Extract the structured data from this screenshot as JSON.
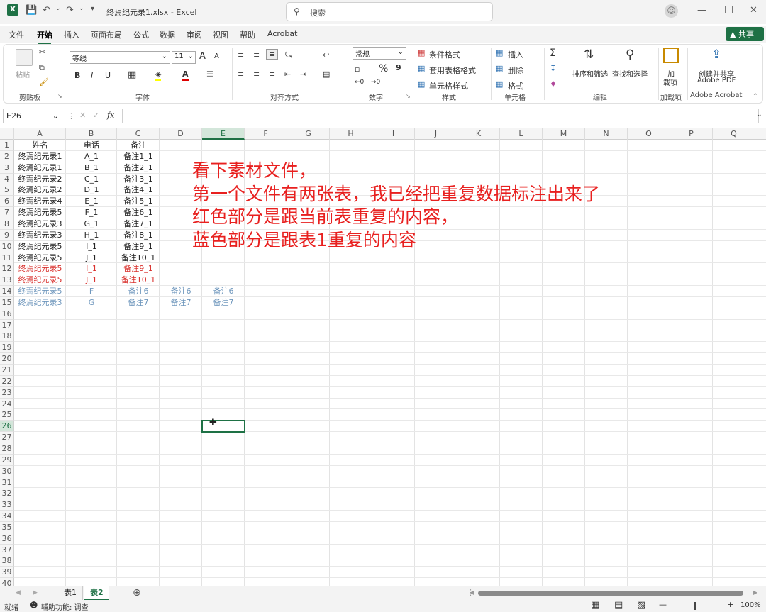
{
  "app": {
    "filename": "终焉纪元录1.xlsx",
    "separator": "-",
    "app_name": "Excel"
  },
  "search": {
    "placeholder": "搜索"
  },
  "ribbon_tabs": [
    "文件",
    "开始",
    "插入",
    "页面布局",
    "公式",
    "数据",
    "审阅",
    "视图",
    "帮助",
    "Acrobat"
  ],
  "share_label": "共享",
  "clipboard": {
    "paste": "粘贴",
    "group": "剪贴板"
  },
  "font": {
    "name": "等线",
    "size": "11",
    "bold": "B",
    "italic": "I",
    "underline": "U",
    "group": "字体",
    "grow": "A",
    "shrink": "A"
  },
  "alignment": {
    "group": "对齐方式"
  },
  "number": {
    "format": "常规",
    "percent": "%",
    "comma": "9",
    "group": "数字"
  },
  "styles": {
    "cond": "条件格式",
    "table": "套用表格格式",
    "cell": "单元格样式",
    "group": "样式"
  },
  "cells": {
    "insert": "插入",
    "delete": "删除",
    "format": "格式",
    "group": "单元格"
  },
  "editing": {
    "sum": "Σ",
    "sort": "排序和筛选",
    "find": "查找和选择",
    "group": "编辑"
  },
  "addins": {
    "label1": "加",
    "label2": "载项",
    "group": "加载项"
  },
  "acrobat": {
    "label1": "创建并共享",
    "label2": "Adobe PDF",
    "group": "Adobe Acrobat"
  },
  "formula_bar": {
    "name_box": "E26",
    "fx": "fx",
    "value": ""
  },
  "columns": [
    "A",
    "B",
    "C",
    "D",
    "E",
    "F",
    "G",
    "H",
    "I",
    "J",
    "K",
    "L",
    "M",
    "N",
    "O",
    "P",
    "Q"
  ],
  "rows": [
    "1",
    "2",
    "3",
    "4",
    "5",
    "6",
    "7",
    "8",
    "9",
    "10",
    "11",
    "12",
    "13",
    "14",
    "15",
    "16",
    "17",
    "18",
    "19",
    "20",
    "21",
    "22",
    "23",
    "24",
    "25",
    "26",
    "27",
    "28",
    "29",
    "30",
    "31",
    "32",
    "33",
    "34",
    "35",
    "36",
    "37",
    "38",
    "39",
    "40"
  ],
  "selected_cell": {
    "col": "E",
    "row": "26"
  },
  "table": [
    {
      "r": 1,
      "c": "A",
      "v": "姓名",
      "k": "n"
    },
    {
      "r": 1,
      "c": "B",
      "v": "电话",
      "k": "n"
    },
    {
      "r": 1,
      "c": "C",
      "v": "备注",
      "k": "n"
    },
    {
      "r": 2,
      "c": "A",
      "v": "终焉纪元录1",
      "k": "n"
    },
    {
      "r": 2,
      "c": "B",
      "v": "A_1",
      "k": "n"
    },
    {
      "r": 2,
      "c": "C",
      "v": "备注1_1",
      "k": "n"
    },
    {
      "r": 3,
      "c": "A",
      "v": "终焉纪元录1",
      "k": "n"
    },
    {
      "r": 3,
      "c": "B",
      "v": "B_1",
      "k": "n"
    },
    {
      "r": 3,
      "c": "C",
      "v": "备注2_1",
      "k": "n"
    },
    {
      "r": 4,
      "c": "A",
      "v": "终焉纪元录2",
      "k": "n"
    },
    {
      "r": 4,
      "c": "B",
      "v": "C_1",
      "k": "n"
    },
    {
      "r": 4,
      "c": "C",
      "v": "备注3_1",
      "k": "n"
    },
    {
      "r": 5,
      "c": "A",
      "v": "终焉纪元录2",
      "k": "n"
    },
    {
      "r": 5,
      "c": "B",
      "v": "D_1",
      "k": "n"
    },
    {
      "r": 5,
      "c": "C",
      "v": "备注4_1",
      "k": "n"
    },
    {
      "r": 6,
      "c": "A",
      "v": "终焉纪元录4",
      "k": "n"
    },
    {
      "r": 6,
      "c": "B",
      "v": "E_1",
      "k": "n"
    },
    {
      "r": 6,
      "c": "C",
      "v": "备注5_1",
      "k": "n"
    },
    {
      "r": 7,
      "c": "A",
      "v": "终焉纪元录5",
      "k": "n"
    },
    {
      "r": 7,
      "c": "B",
      "v": "F_1",
      "k": "n"
    },
    {
      "r": 7,
      "c": "C",
      "v": "备注6_1",
      "k": "n"
    },
    {
      "r": 8,
      "c": "A",
      "v": "终焉纪元录3",
      "k": "n"
    },
    {
      "r": 8,
      "c": "B",
      "v": "G_1",
      "k": "n"
    },
    {
      "r": 8,
      "c": "C",
      "v": "备注7_1",
      "k": "n"
    },
    {
      "r": 9,
      "c": "A",
      "v": "终焉纪元录3",
      "k": "n"
    },
    {
      "r": 9,
      "c": "B",
      "v": "H_1",
      "k": "n"
    },
    {
      "r": 9,
      "c": "C",
      "v": "备注8_1",
      "k": "n"
    },
    {
      "r": 10,
      "c": "A",
      "v": "终焉纪元录5",
      "k": "n"
    },
    {
      "r": 10,
      "c": "B",
      "v": "I_1",
      "k": "n"
    },
    {
      "r": 10,
      "c": "C",
      "v": "备注9_1",
      "k": "n"
    },
    {
      "r": 11,
      "c": "A",
      "v": "终焉纪元录5",
      "k": "n"
    },
    {
      "r": 11,
      "c": "B",
      "v": "J_1",
      "k": "n"
    },
    {
      "r": 11,
      "c": "C",
      "v": "备注10_1",
      "k": "n"
    },
    {
      "r": 12,
      "c": "A",
      "v": "终焉纪元录5",
      "k": "r"
    },
    {
      "r": 12,
      "c": "B",
      "v": "I_1",
      "k": "r"
    },
    {
      "r": 12,
      "c": "C",
      "v": "备注9_1",
      "k": "r"
    },
    {
      "r": 13,
      "c": "A",
      "v": "终焉纪元录5",
      "k": "r"
    },
    {
      "r": 13,
      "c": "B",
      "v": "J_1",
      "k": "r"
    },
    {
      "r": 13,
      "c": "C",
      "v": "备注10_1",
      "k": "r"
    },
    {
      "r": 14,
      "c": "A",
      "v": "终焉纪元录5",
      "k": "b"
    },
    {
      "r": 14,
      "c": "B",
      "v": "F",
      "k": "b"
    },
    {
      "r": 14,
      "c": "C",
      "v": "备注6",
      "k": "b"
    },
    {
      "r": 14,
      "c": "D",
      "v": "备注6",
      "k": "b"
    },
    {
      "r": 14,
      "c": "E",
      "v": "备注6",
      "k": "b"
    },
    {
      "r": 15,
      "c": "A",
      "v": "终焉纪元录3",
      "k": "b"
    },
    {
      "r": 15,
      "c": "B",
      "v": "G",
      "k": "b"
    },
    {
      "r": 15,
      "c": "C",
      "v": "备注7",
      "k": "b"
    },
    {
      "r": 15,
      "c": "D",
      "v": "备注7",
      "k": "b"
    },
    {
      "r": 15,
      "c": "E",
      "v": "备注7",
      "k": "b"
    }
  ],
  "colors": {
    "normal": "#222222",
    "red": "#d9312d",
    "blue": "#6f97bd",
    "accent": "#1e7145",
    "note": "#e8201f"
  },
  "note_lines": [
    "看下素材文件，",
    "第一个文件有两张表，我已经把重复数据标注出来了",
    "红色部分是跟当前表重复的内容，",
    "蓝色部分是跟表1重复的内容"
  ],
  "sheets": [
    "表1",
    "表2"
  ],
  "active_sheet": "表2",
  "status": {
    "ready": "就绪",
    "accessibility": "辅助功能: 调查",
    "zoom": "100%"
  }
}
